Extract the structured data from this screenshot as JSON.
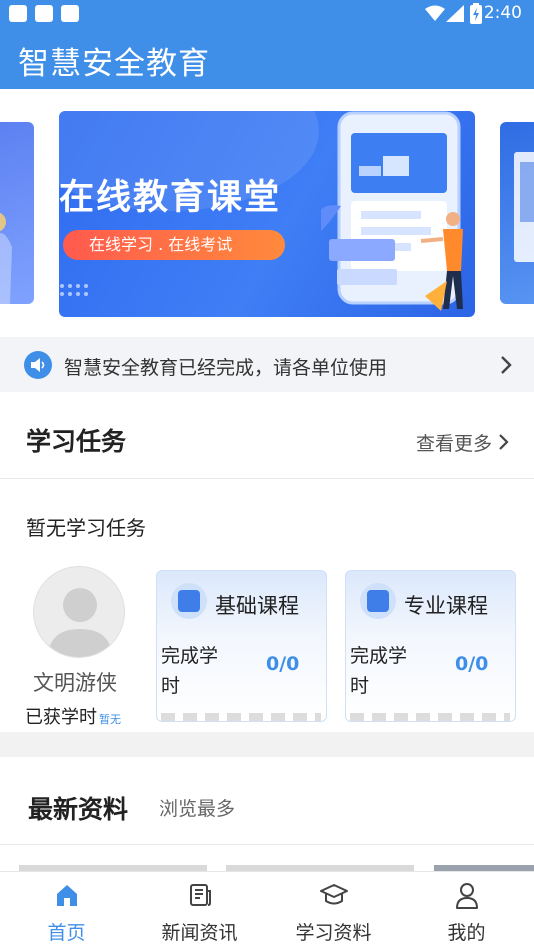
{
  "status_bar": {
    "time": "2:40",
    "icons": [
      "notification-square-icon",
      "notification-square-icon",
      "notification-square-icon",
      "wifi-icon",
      "signal-icon",
      "battery-icon"
    ]
  },
  "app_bar": {
    "title": "智慧安全教育"
  },
  "banner": {
    "headline": "在线教育课堂",
    "pill_text": "在线学习 . 在线考试"
  },
  "notice": {
    "text": "智慧安全教育已经完成，请各单位使用",
    "icon": "speaker-icon"
  },
  "tasks": {
    "title": "学习任务",
    "more_label": "查看更多",
    "empty_text": "暂无学习任务",
    "user": {
      "name": "文明游侠",
      "hours_label": "已获学时",
      "hours_value": "暂无"
    },
    "courses": [
      {
        "title": "基础课程",
        "label": "完成学时",
        "value": "0/0"
      },
      {
        "title": "专业课程",
        "label": "完成学时",
        "value": "0/0"
      }
    ]
  },
  "latest": {
    "title": "最新资料",
    "sub_label": "浏览最多"
  },
  "bottom_nav": {
    "items": [
      {
        "label": "首页",
        "icon": "home-icon",
        "active": true
      },
      {
        "label": "新闻资讯",
        "icon": "news-icon",
        "active": false
      },
      {
        "label": "学习资料",
        "icon": "graduation-cap-icon",
        "active": false
      },
      {
        "label": "我的",
        "icon": "person-icon",
        "active": false
      }
    ]
  },
  "colors": {
    "primary": "#3f8fe8",
    "banner_blue": "#2f6cf1",
    "pill_orange": "#ff6a45"
  }
}
